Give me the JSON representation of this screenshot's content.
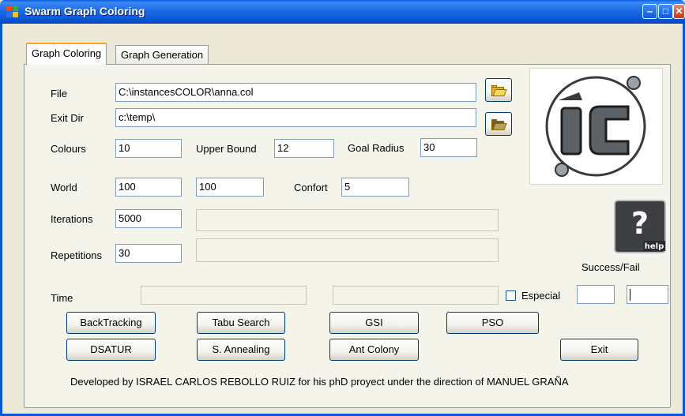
{
  "window": {
    "title": "Swarm Graph Coloring"
  },
  "tabs": [
    {
      "label": "Graph Coloring",
      "active": true
    },
    {
      "label": "Graph Generation",
      "active": false
    }
  ],
  "form": {
    "file": {
      "label": "File",
      "value": "C:\\instancesCOLOR\\anna.col"
    },
    "exit_dir": {
      "label": "Exit Dir",
      "value": "c:\\temp\\"
    },
    "colours": {
      "label": "Colours",
      "value": "10"
    },
    "upper_bound": {
      "label": "Upper Bound",
      "value": "12"
    },
    "goal_radius": {
      "label": "Goal Radius",
      "value": "30"
    },
    "world": {
      "label": "World",
      "value_x": "100",
      "value_y": "100"
    },
    "confort": {
      "label": "Confort",
      "value": "5"
    },
    "iterations": {
      "label": "Iterations",
      "value": "5000"
    },
    "repetitions": {
      "label": "Repetitions",
      "value": "30"
    },
    "time": {
      "label": "Time"
    },
    "especial": {
      "label": "Especial",
      "checked": false
    },
    "success_fail": {
      "label": "Success/Fail"
    }
  },
  "buttons": {
    "backtracking": "BackTracking",
    "tabu_search": "Tabu Search",
    "gsi": "GSI",
    "pso": "PSO",
    "dsatur": "DSATUR",
    "s_annealing": "S. Annealing",
    "ant_colony": "Ant Colony",
    "exit": "Exit"
  },
  "icons": {
    "open_file": "folder-open-icon",
    "open_dir": "folder-dark-icon",
    "logo": "ic-logo",
    "help": "help-icon"
  },
  "help_text": "help",
  "footer": "Developed by ISRAEL CARLOS REBOLLO RUIZ for his phD proyect under the direction of MANUEL GRAÑA",
  "colors": {
    "titlebar": "#0a58d8",
    "window_bg": "#ece9d8",
    "button_border": "#003c74"
  }
}
